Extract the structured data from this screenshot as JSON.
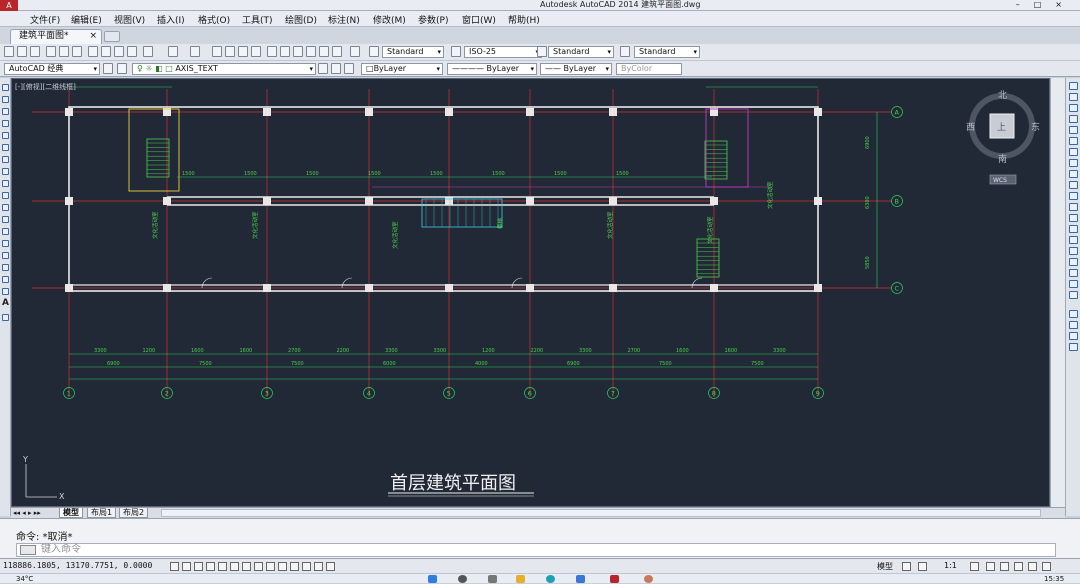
{
  "window": {
    "title": "Autodesk AutoCAD 2014    建筑平面图.dwg",
    "logo": "A"
  },
  "menu": [
    "文件(F)",
    "编辑(E)",
    "视图(V)",
    "插入(I)",
    "格式(O)",
    "工具(T)",
    "绘图(D)",
    "标注(N)",
    "修改(M)",
    "参数(P)",
    "窗口(W)",
    "帮助(H)"
  ],
  "doc_tab": {
    "label": "建筑平面图*",
    "close": "×"
  },
  "toolbar1": {
    "text_style": "Standard",
    "dim_style": "ISO-25",
    "table_style": "Standard",
    "mleader_style": "Standard"
  },
  "toolbar2": {
    "workspace": "AutoCAD 经典",
    "layer": "AXIS_TEXT",
    "color": "ByLayer",
    "linetype": "ByLayer",
    "lineweight": "ByLayer",
    "plotstyle": "ByColor"
  },
  "viewport": {
    "label": "[-][俯视][二维线框]",
    "drawing_title": "首层建筑平面图",
    "grid_axes_bottom": [
      "1",
      "2",
      "3",
      "4",
      "5",
      "6",
      "7",
      "8",
      "9"
    ],
    "grid_axes_right": [
      "A",
      "B",
      "C"
    ],
    "dims_bottom_overall": [
      "6900",
      "7500",
      "7500",
      "6000",
      "4000",
      "6900",
      "7500",
      "7500"
    ],
    "dims_bottom_detail": [
      "3300",
      "1200",
      "1600",
      "1600",
      "2700",
      "2200",
      "3300",
      "3300",
      "1200",
      "2200",
      "3300",
      "2700",
      "1600",
      "1600",
      "3300"
    ],
    "dims_top": [
      "1500",
      "1500",
      "1500",
      "1500",
      "1500",
      "1500",
      "1500",
      "1500"
    ],
    "dims_right": [
      "6900",
      "6300",
      "5850"
    ],
    "room_labels": [
      "文化活动室",
      "文化活动室",
      "文化活动室",
      "文化活动室",
      "文化活动室",
      "文化活动室",
      "楼梯"
    ],
    "ucs_x": "X",
    "ucs_y": "Y"
  },
  "viewcube": {
    "north": "北",
    "south": "南",
    "east": "东",
    "west": "西",
    "top": "上",
    "wcs": "WCS"
  },
  "layout_tabs": [
    "模型",
    "布局1",
    "布局2"
  ],
  "command": {
    "history": "命令: *取消*",
    "placeholder": "键入命令"
  },
  "status": {
    "coords": "118886.1805, 13170.7751, 0.0000",
    "model": "模型",
    "scale": "1:1",
    "time": "15:35"
  },
  "taskbar": {
    "temp": "34°C"
  },
  "colors": {
    "canvas": "#212836",
    "wall": "#e8e8e8",
    "axis": "#d33030",
    "dim": "#2fd060",
    "text_green": "#4dd24d",
    "yellow": "#e6d23a",
    "magenta": "#c03cc0",
    "cyan": "#3ccfe6"
  }
}
